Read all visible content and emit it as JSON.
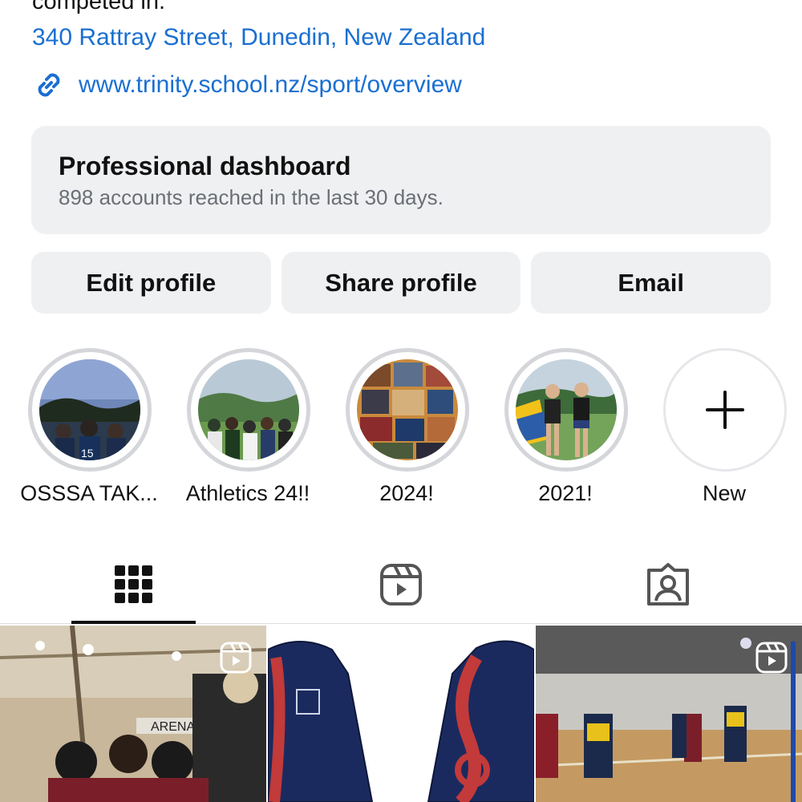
{
  "profile": {
    "bio_tail": "competed in.",
    "address": "340 Rattray Street, Dunedin, New Zealand",
    "website": "www.trinity.school.nz/sport/overview"
  },
  "dashboard": {
    "title": "Professional dashboard",
    "subtitle": "898 accounts reached in the last 30 days."
  },
  "actions": {
    "edit": "Edit profile",
    "share": "Share profile",
    "email": "Email"
  },
  "highlights": [
    {
      "label": "OSSSA TAK...",
      "icon": "night-field-photo"
    },
    {
      "label": "Athletics 24!!",
      "icon": "group-field-photo"
    },
    {
      "label": "2024!",
      "icon": "collage-photo"
    },
    {
      "label": "2021!",
      "icon": "two-girls-field-photo"
    },
    {
      "label": "New",
      "icon": "plus-icon"
    }
  ],
  "tabs": [
    {
      "name": "posts",
      "icon": "grid-icon",
      "active": true
    },
    {
      "name": "reels",
      "icon": "reels-icon",
      "active": false
    },
    {
      "name": "tagged",
      "icon": "tagged-person-icon",
      "active": false
    }
  ],
  "grid": [
    {
      "type": "reel",
      "subject": "basketball team huddle in arena"
    },
    {
      "type": "post",
      "subject": "navy hoodie with red design"
    },
    {
      "type": "reel",
      "subject": "netball game in indoor court"
    }
  ],
  "colors": {
    "link": "#1a6fd1",
    "button_bg": "#eff0f2",
    "muted_text": "#6b6f75",
    "ring": "#d4d6da"
  }
}
